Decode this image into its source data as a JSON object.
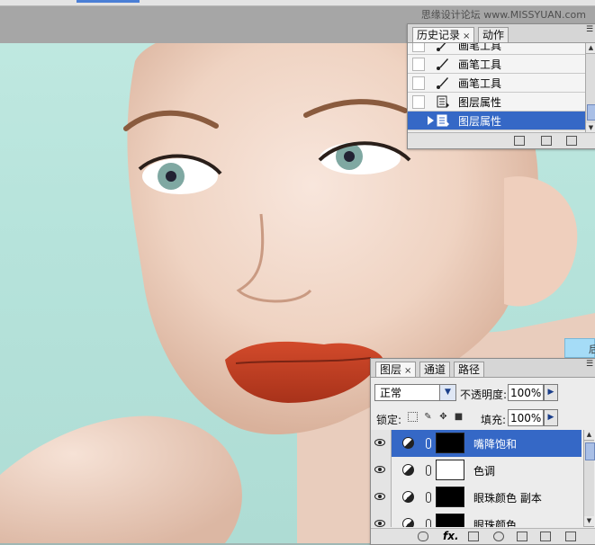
{
  "watermark": "思缘设计论坛 www.MISSYUAN.com",
  "history_panel": {
    "tabs": [
      {
        "label": "历史记录",
        "close": "×"
      },
      {
        "label": "动作"
      }
    ],
    "rows": [
      {
        "label": "画笔工具",
        "icon": "brush-icon",
        "selected": false
      },
      {
        "label": "画笔工具",
        "icon": "brush-icon",
        "selected": false
      },
      {
        "label": "画笔工具",
        "icon": "brush-icon",
        "selected": false
      },
      {
        "label": "图层属性",
        "icon": "layer-properties-icon",
        "selected": false
      },
      {
        "label": "图层属性",
        "icon": "layer-properties-icon",
        "selected": true
      }
    ]
  },
  "layers_panel": {
    "tabs": [
      {
        "label": "图层",
        "close": "×"
      },
      {
        "label": "通道"
      },
      {
        "label": "路径"
      }
    ],
    "blend_mode": "正常",
    "opacity_label": "不透明度:",
    "opacity_value": "100%",
    "lock_label": "锁定:",
    "fill_label": "填充:",
    "fill_value": "100%",
    "layers": [
      {
        "name": "嘴降饱和",
        "selected": true,
        "mask": "black"
      },
      {
        "name": "色调",
        "selected": false,
        "mask": "white"
      },
      {
        "name": "眼珠颜色 副本",
        "selected": false,
        "mask": "black"
      },
      {
        "name": "眼珠颜色",
        "selected": false,
        "mask": "black"
      }
    ],
    "footer_fx": "fx."
  },
  "side_swatch_text": "后",
  "colors": {
    "selection": "#3568c6",
    "canvas_bg": "#b6e3db",
    "lip": "#c8452b"
  }
}
